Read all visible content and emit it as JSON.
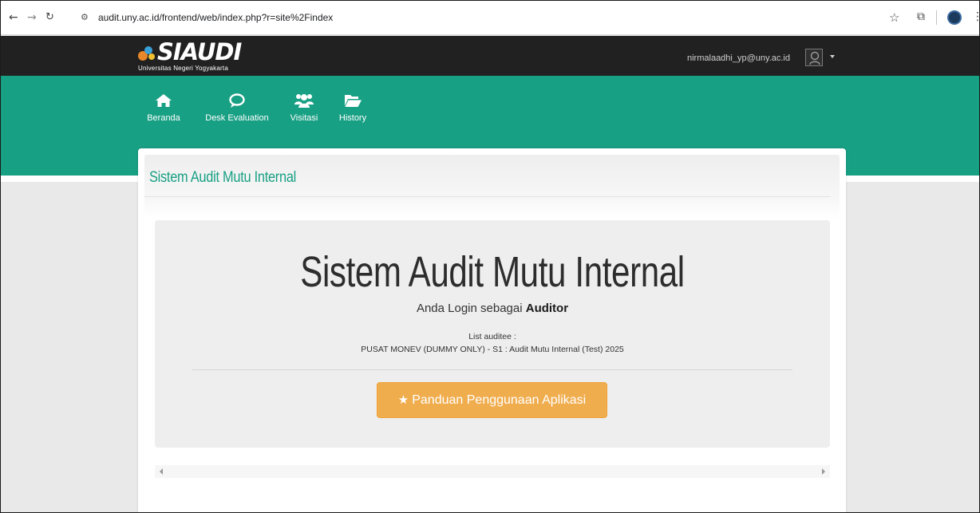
{
  "browser": {
    "url": "audit.uny.ac.id/frontend/web/index.php?r=site%2Findex",
    "icons": [
      "back-arrow-icon",
      "forward-arrow-icon",
      "reload-icon",
      "site-settings-icon",
      "bookmark-star-icon",
      "extensions-icon",
      "profile-icon",
      "more-menu-icon"
    ]
  },
  "topbar": {
    "logo_text": "SIAUDI",
    "logo_subtitle": "Universitas Negeri Yogyakarta",
    "user_email": "nirmalaadhi_yp@uny.ac.id"
  },
  "menu": [
    {
      "label": "Beranda",
      "icon": "home-icon"
    },
    {
      "label": "Desk Evaluation",
      "icon": "comment-icon"
    },
    {
      "label": "Visitasi",
      "icon": "users-icon"
    },
    {
      "label": "History",
      "icon": "folder-open-icon"
    }
  ],
  "card": {
    "title": "Sistem Audit Mutu Internal"
  },
  "jumbotron": {
    "title": "Sistem Audit Mutu Internal",
    "login_prefix": "Anda Login sebagai",
    "role": "Auditor",
    "list_label": "List auditee :",
    "list_value": "PUSAT MONEV (DUMMY ONLY) - S1 : Audit Mutu Internal (Test) 2025",
    "button_label": "Panduan Penggunaan Aplikasi"
  },
  "colors": {
    "topbar": "#212121",
    "brand_green": "#18a084",
    "button_orange": "#f0ad4e",
    "background": "#e9e9e9"
  }
}
